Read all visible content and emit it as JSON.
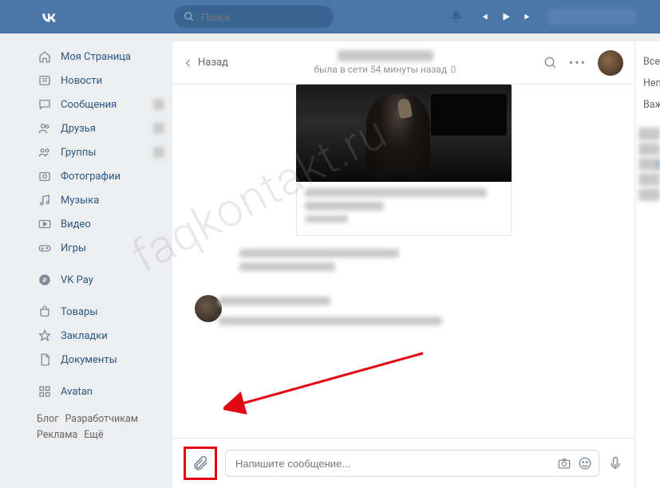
{
  "header": {
    "search_placeholder": "Поиск"
  },
  "sidebar": {
    "items": [
      {
        "label": "Моя Страница"
      },
      {
        "label": "Новости"
      },
      {
        "label": "Сообщения"
      },
      {
        "label": "Друзья"
      },
      {
        "label": "Группы"
      },
      {
        "label": "Фотографии"
      },
      {
        "label": "Музыка"
      },
      {
        "label": "Видео"
      },
      {
        "label": "Игры"
      }
    ],
    "vkpay": "VK Pay",
    "extras": [
      {
        "label": "Товары"
      },
      {
        "label": "Закладки"
      },
      {
        "label": "Документы"
      }
    ],
    "apps": [
      {
        "label": "Avatan"
      }
    ]
  },
  "footer": {
    "links": [
      "Блог",
      "Разработчикам",
      "Реклама",
      "Ещё"
    ]
  },
  "chat": {
    "back_label": "Назад",
    "status": "была в сети 54 минуты назад",
    "input_placeholder": "Напишите сообщение..."
  },
  "right": {
    "items": [
      "Все",
      "Неп",
      "Важ"
    ]
  },
  "watermark": "faqkontakt.ru"
}
